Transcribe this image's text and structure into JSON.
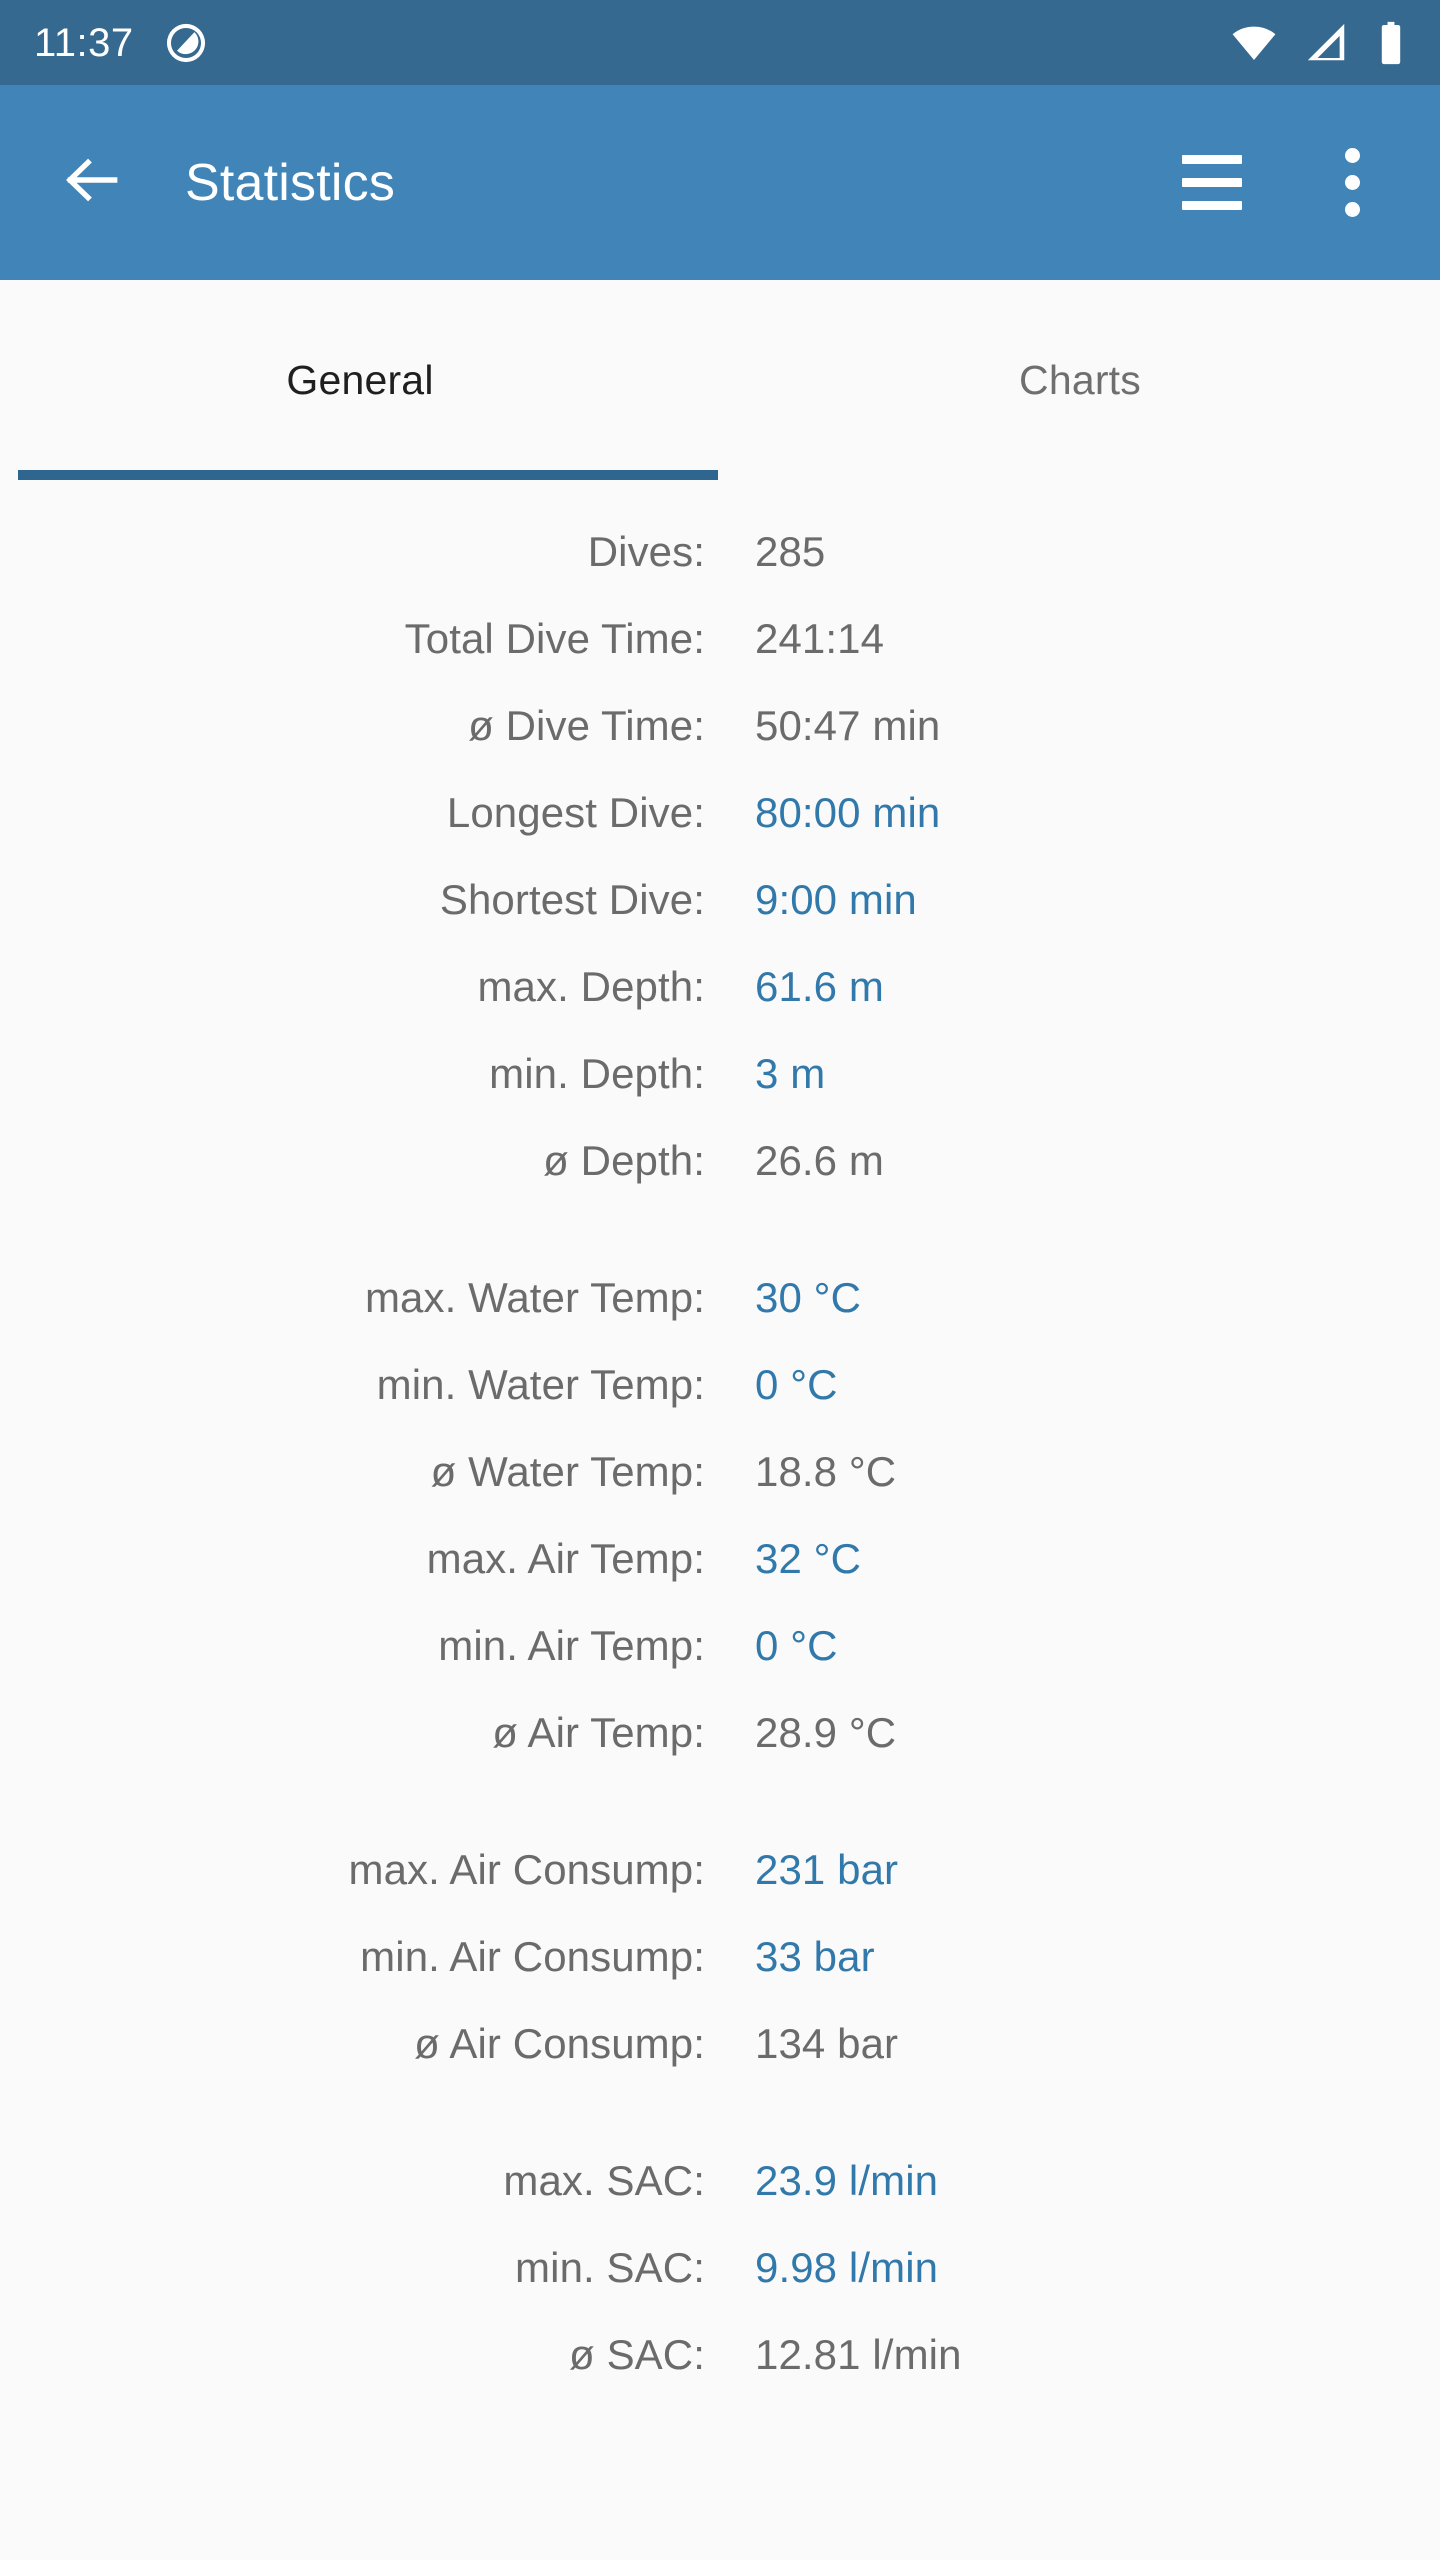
{
  "status_bar": {
    "clock": "11:37",
    "icons": [
      "notification-circle-icon",
      "wifi-icon",
      "cell-signal-icon",
      "battery-icon"
    ],
    "background_color": "#35698f"
  },
  "app_bar": {
    "back_label": "back-arrow",
    "title": "Statistics",
    "menu_label": "menu",
    "overflow_label": "more-options",
    "background_color": "#4184b7"
  },
  "tabs": {
    "items": [
      {
        "label": "General",
        "active": true
      },
      {
        "label": "Charts",
        "active": false
      }
    ],
    "indicator_color": "#2f6690"
  },
  "colors": {
    "label": "#6b6b6b",
    "value": "#6b6b6b",
    "link_value": "#3279ab",
    "page_background": "#fafafa"
  },
  "stats": {
    "groups": [
      {
        "rows": [
          {
            "label": "Dives:",
            "value": "285",
            "link": false
          },
          {
            "label": "Total Dive Time:",
            "value": "241:14",
            "link": false
          },
          {
            "label": "ø Dive Time:",
            "value": "50:47 min",
            "link": false
          },
          {
            "label": "Longest Dive:",
            "value": "80:00 min",
            "link": true
          },
          {
            "label": "Shortest Dive:",
            "value": "9:00 min",
            "link": true
          },
          {
            "label": "max. Depth:",
            "value": "61.6 m",
            "link": true
          },
          {
            "label": "min. Depth:",
            "value": "3 m",
            "link": true
          },
          {
            "label": "ø Depth:",
            "value": "26.6 m",
            "link": false
          }
        ]
      },
      {
        "rows": [
          {
            "label": "max. Water Temp:",
            "value": "30 °C",
            "link": true
          },
          {
            "label": "min. Water Temp:",
            "value": "0 °C",
            "link": true
          },
          {
            "label": "ø Water Temp:",
            "value": "18.8 °C",
            "link": false
          },
          {
            "label": "max. Air Temp:",
            "value": "32 °C",
            "link": true
          },
          {
            "label": "min. Air Temp:",
            "value": "0 °C",
            "link": true
          },
          {
            "label": "ø Air Temp:",
            "value": "28.9 °C",
            "link": false
          }
        ]
      },
      {
        "rows": [
          {
            "label": "max. Air Consump:",
            "value": "231 bar",
            "link": true
          },
          {
            "label": "min. Air Consump:",
            "value": "33 bar",
            "link": true
          },
          {
            "label": "ø Air Consump:",
            "value": "134 bar",
            "link": false
          }
        ]
      },
      {
        "rows": [
          {
            "label": "max. SAC:",
            "value": "23.9 l/min",
            "link": true
          },
          {
            "label": "min. SAC:",
            "value": "9.98 l/min",
            "link": true
          },
          {
            "label": "ø SAC:",
            "value": "12.81 l/min",
            "link": false
          }
        ]
      }
    ]
  }
}
